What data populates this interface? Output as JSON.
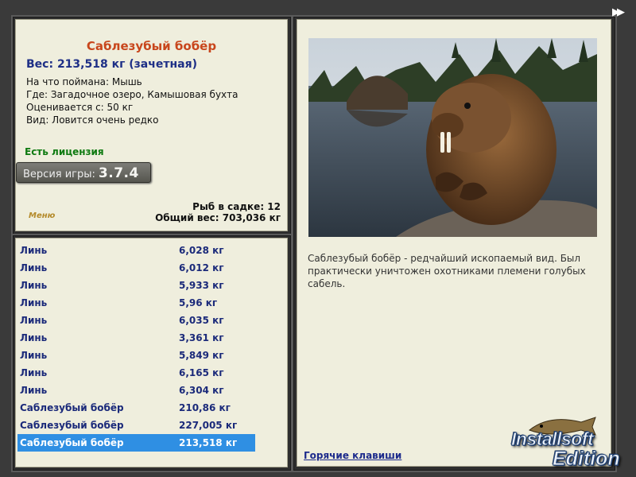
{
  "fish": {
    "title": "Саблезубый бобёр",
    "weight_line": "Вес: 213,518 кг (зачетная)",
    "attributes": [
      "На что поймана: Мышь",
      "Где: Загадочное озеро, Камышовая бухта",
      "Оценивается с: 50 кг",
      "Вид: Ловится очень редко"
    ],
    "license": "Есть лицензия",
    "version_label": "Версия игры:",
    "version_number": "3.7.4",
    "cage_count": "Рыб в садке: 12",
    "total_weight": "Общий вес: 703,036 кг",
    "menu_link": "Меню"
  },
  "catch_list": [
    {
      "name": "Линь",
      "weight": "6,028 кг"
    },
    {
      "name": "Линь",
      "weight": "6,012 кг"
    },
    {
      "name": "Линь",
      "weight": "5,933 кг"
    },
    {
      "name": "Линь",
      "weight": "5,96 кг"
    },
    {
      "name": "Линь",
      "weight": "6,035 кг"
    },
    {
      "name": "Линь",
      "weight": "3,361 кг"
    },
    {
      "name": "Линь",
      "weight": "5,849 кг"
    },
    {
      "name": "Линь",
      "weight": "6,165 кг"
    },
    {
      "name": "Линь",
      "weight": "6,304 кг"
    },
    {
      "name": "Саблезубый бобёр",
      "weight": "210,86 кг"
    },
    {
      "name": "Саблезубый бобёр",
      "weight": "227,005 кг"
    },
    {
      "name": "Саблезубый бобёр",
      "weight": "213,518 кг"
    }
  ],
  "selected_index": 11,
  "description": "Саблезубый бобёр - редчайший ископаемый вид. Был практически уничтожен охотниками племени голубых сабель.",
  "hotkeys": "Горячие клавиши",
  "brand": {
    "line1": "Installsoft",
    "line2": "Edition"
  },
  "icons": {
    "forward": "fast-forward-icon"
  },
  "colors": {
    "title": "#c8461c",
    "weight": "#1e2f86",
    "license": "#0e7a10",
    "selected_row": "#2f8fe3",
    "panel": "#efeedd"
  }
}
